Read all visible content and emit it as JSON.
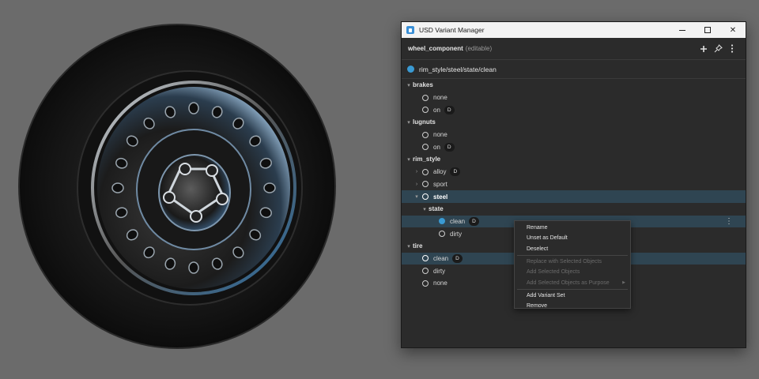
{
  "window": {
    "title": "USD Variant Manager",
    "minimize_glyph": "—",
    "close_glyph": "✕"
  },
  "header": {
    "component_name": "wheel_component",
    "component_tag": "(editable)",
    "icons": [
      "plus-icon",
      "pin-icon",
      "more-vertical-icon"
    ]
  },
  "selected_path": "rim_style/steel/state/clean",
  "tree": {
    "brakes": {
      "label": "brakes",
      "options": [
        {
          "label": "none"
        },
        {
          "label": "on",
          "badge": "D"
        }
      ]
    },
    "lugnuts": {
      "label": "lugnuts",
      "options": [
        {
          "label": "none"
        },
        {
          "label": "on",
          "badge": "D"
        }
      ]
    },
    "rim_style": {
      "label": "rim_style",
      "options": [
        {
          "label": "alloy",
          "badge": "D"
        },
        {
          "label": "sport"
        },
        {
          "label": "steel"
        }
      ],
      "state": {
        "label": "state",
        "options": [
          {
            "label": "clean",
            "badge": "D"
          },
          {
            "label": "dirty"
          }
        ]
      }
    },
    "tire": {
      "label": "tire",
      "options": [
        {
          "label": "clean",
          "badge": "D"
        },
        {
          "label": "dirty"
        },
        {
          "label": "none"
        }
      ]
    }
  },
  "context_menu": {
    "items": [
      {
        "label": "Rename",
        "enabled": true
      },
      {
        "label": "Unset as Default",
        "enabled": true
      },
      {
        "label": "Deselect",
        "enabled": true
      },
      {
        "label": "Replace with Selected Objects",
        "enabled": false
      },
      {
        "label": "Add Selected Objects",
        "enabled": false
      },
      {
        "label": "Add Selected Objects as Purpose",
        "enabled": false,
        "submenu": true
      },
      {
        "label": "Add Variant Set",
        "enabled": true
      },
      {
        "label": "Remove",
        "enabled": true
      }
    ]
  },
  "colors": {
    "accent": "#3a9ad3",
    "highlight_row": "#2f4552",
    "panel_bg": "#2b2b2b",
    "viewport_bg": "#6b6b6b"
  }
}
